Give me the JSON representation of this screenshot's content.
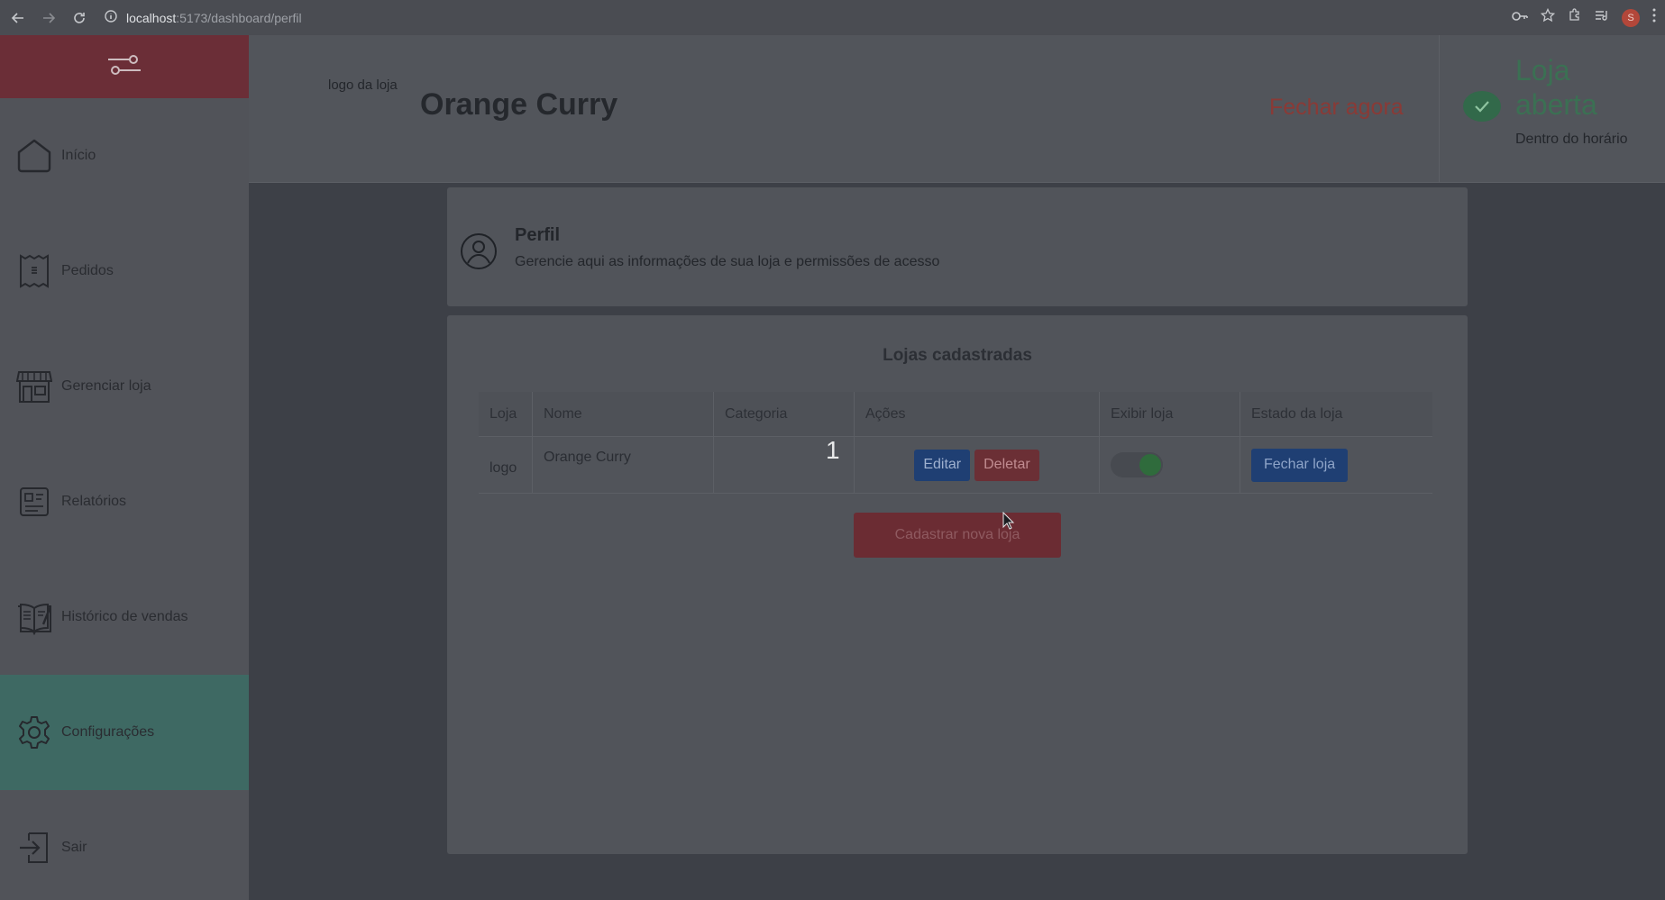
{
  "browser": {
    "url_host": "localhost",
    "url_path": ":5173/dashboard/perfil",
    "profile_initial": "S"
  },
  "sidebar": {
    "items": [
      {
        "label": "Início",
        "icon": "home-icon"
      },
      {
        "label": "Pedidos",
        "icon": "receipt-icon"
      },
      {
        "label": "Gerenciar loja",
        "icon": "store-icon"
      },
      {
        "label": "Relatórios",
        "icon": "report-icon"
      },
      {
        "label": "Histórico de vendas",
        "icon": "book-icon"
      },
      {
        "label": "Configurações",
        "icon": "gear-icon",
        "active": true
      },
      {
        "label": "Sair",
        "icon": "logout-icon"
      }
    ]
  },
  "header": {
    "logo_alt": "logo da loja",
    "store_name": "Orange Curry",
    "close_now": "Fechar agora",
    "status": "Loja aberta",
    "status_sub": "Dentro do horário"
  },
  "profile": {
    "title": "Perfil",
    "subtitle": "Gerencie aqui as informações de sua loja e permissões de acesso"
  },
  "stores": {
    "title": "Lojas cadastradas",
    "columns": [
      "Loja",
      "Nome",
      "Categoria",
      "Ações",
      "Exibir loja",
      "Estado da loja"
    ],
    "rows": [
      {
        "logo_alt": "logo",
        "name": "Orange Curry",
        "category": "",
        "edit_label": "Editar",
        "delete_label": "Deletar",
        "show_store": true,
        "state_button": "Fechar loja"
      }
    ],
    "register_button": "Cadastrar nova loja"
  },
  "overlay": {
    "step_number": "1"
  },
  "colors": {
    "brand_red": "#6b2e37",
    "active_teal": "#3e6963",
    "open_green": "#3b7053",
    "button_blue": "#1f3f73"
  }
}
